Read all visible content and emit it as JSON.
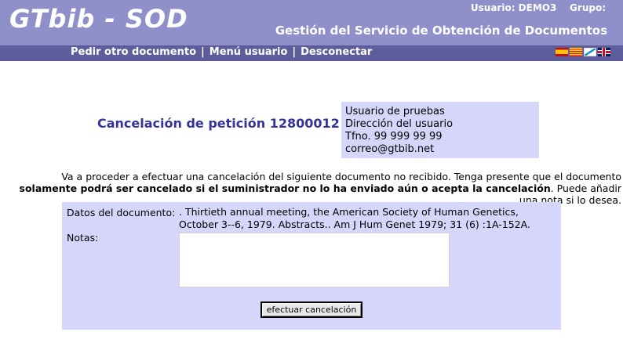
{
  "app": {
    "logo": "GTbib - SOD",
    "user_line": "Usuario: DEMO3    Grupo:",
    "subtitle": "Gestión del Servicio de Obtención de Documentos"
  },
  "nav": {
    "items": [
      "Pedir otro documento",
      "Menú usuario",
      "Desconectar"
    ],
    "separator": "|"
  },
  "languages": [
    {
      "code": "es",
      "icon": "flag-es-icon"
    },
    {
      "code": "ca",
      "icon": "flag-ca-icon"
    },
    {
      "code": "gl",
      "icon": "flag-gl-icon"
    },
    {
      "code": "en",
      "icon": "flag-en-icon"
    }
  ],
  "page": {
    "title": "Cancelación de petición 12800012"
  },
  "user": {
    "name": "Usuario de pruebas",
    "address": "Dirección del usuario",
    "phone": "Tfno. 99 999 99 99",
    "email": "correo@gtbib.net"
  },
  "notice": {
    "intro": "Va a proceder a efectuar una cancelación del siguiente documento no recibido. Tenga presente que el documento ",
    "bold": "solamente podrá ser cancelado si el suministrador no lo ha enviado aún o acepta la cancelación",
    "outro": ". Puede añadir una nota si lo desea."
  },
  "form": {
    "doc_label": "Datos del documento:",
    "doc_value": ". Thirtieth annual meeting, the American Society of Human Genetics, October 3--6, 1979. Abstracts.. Am J Hum Genet 1979; 31 (6) :1A-152A.",
    "notes_label": "Notas:",
    "notes_value": "",
    "submit_label": "efectuar  cancelación"
  },
  "colors": {
    "header": "#8f8fc9",
    "navbar": "#5d5d9b",
    "panel": "#d6d6fa",
    "title": "#33339a"
  }
}
